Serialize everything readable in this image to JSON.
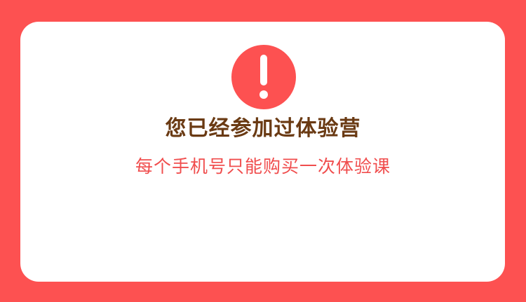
{
  "dialog": {
    "icon": "exclamation-circle-icon",
    "title": "您已经参加过体验营",
    "message": "每个手机号只能购买一次体验课"
  },
  "colors": {
    "background": "#fd5151",
    "card": "#ffffff",
    "icon": "#fd5151",
    "title": "#6a3a13",
    "message": "#f04d4d"
  }
}
